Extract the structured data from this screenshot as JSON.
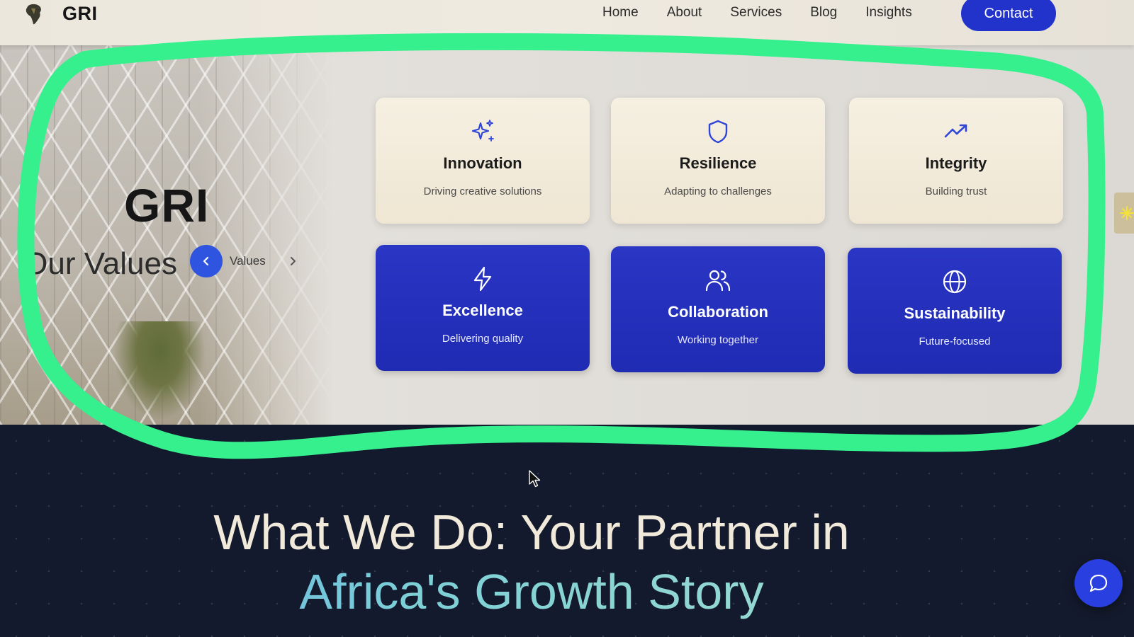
{
  "header": {
    "brand": "GRI",
    "logo_icon": "africa-map-icon",
    "nav": [
      "Home",
      "About",
      "Services",
      "Blog",
      "Insights"
    ],
    "contact_label": "Contact"
  },
  "values": {
    "title": "GRI",
    "subtitle": "Our Values",
    "slider_label": "Values",
    "prev_icon": "chevron-left-icon",
    "next_icon": "chevron-right-icon",
    "cards": [
      {
        "title": "Innovation",
        "desc": "Driving creative solutions",
        "icon": "sparkles-icon",
        "variant": "light"
      },
      {
        "title": "Resilience",
        "desc": "Adapting to challenges",
        "icon": "shield-icon",
        "variant": "light"
      },
      {
        "title": "Integrity",
        "desc": "Building trust",
        "icon": "trending-up-icon",
        "variant": "light"
      },
      {
        "title": "Excellence",
        "desc": "Delivering quality",
        "icon": "lightning-icon",
        "variant": "dark"
      },
      {
        "title": "Collaboration",
        "desc": "Working together",
        "icon": "users-icon",
        "variant": "dark"
      },
      {
        "title": "Sustainability",
        "desc": "Future-focused",
        "icon": "globe-icon",
        "variant": "dark"
      }
    ]
  },
  "whatwedo": {
    "line1": "What We Do: Your Partner in",
    "line2": "Africa's Growth Story"
  },
  "chat_icon": "chat-bubble-icon",
  "colors": {
    "accent": "#2233cc",
    "highlight": "#35f08c",
    "dark_bg": "#141a2d"
  }
}
